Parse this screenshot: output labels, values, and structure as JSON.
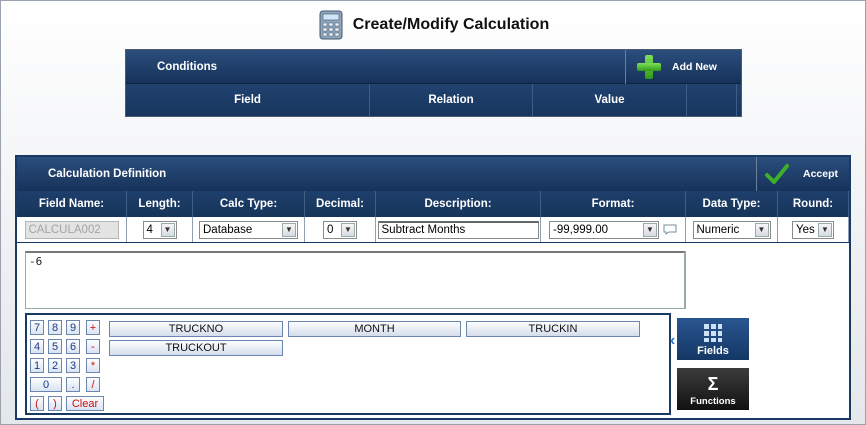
{
  "header": {
    "title": "Create/Modify Calculation",
    "icon": "calculator-icon"
  },
  "conditions": {
    "title": "Conditions",
    "add_new_label": "Add New",
    "columns": [
      "Field",
      "Relation",
      "Value"
    ]
  },
  "calc_def": {
    "title": "Calculation Definition",
    "accept_label": "Accept",
    "columns": [
      "Field Name:",
      "Length:",
      "Calc Type:",
      "Decimal:",
      "Description:",
      "Format:",
      "Data Type:",
      "Round:"
    ],
    "values": {
      "field_name": "CALCULA002",
      "length": "4",
      "calc_type": "Database",
      "decimal": "0",
      "description": "Subtract Months",
      "format": "-99,999.00",
      "data_type": "Numeric",
      "round": "Yes"
    },
    "expression": "-6"
  },
  "builder": {
    "keys": [
      [
        "7",
        "8",
        "9",
        "+"
      ],
      [
        "4",
        "5",
        "6",
        "-"
      ],
      [
        "1",
        "2",
        "3",
        "*"
      ],
      [
        "0",
        ".",
        "/"
      ],
      [
        "(",
        ")",
        "Clear"
      ]
    ],
    "fields": [
      "TRUCKNO",
      "MONTH",
      "TRUCKIN",
      "TRUCKOUT"
    ]
  },
  "side": {
    "fields_label": "Fields",
    "functions_label": "Functions"
  }
}
